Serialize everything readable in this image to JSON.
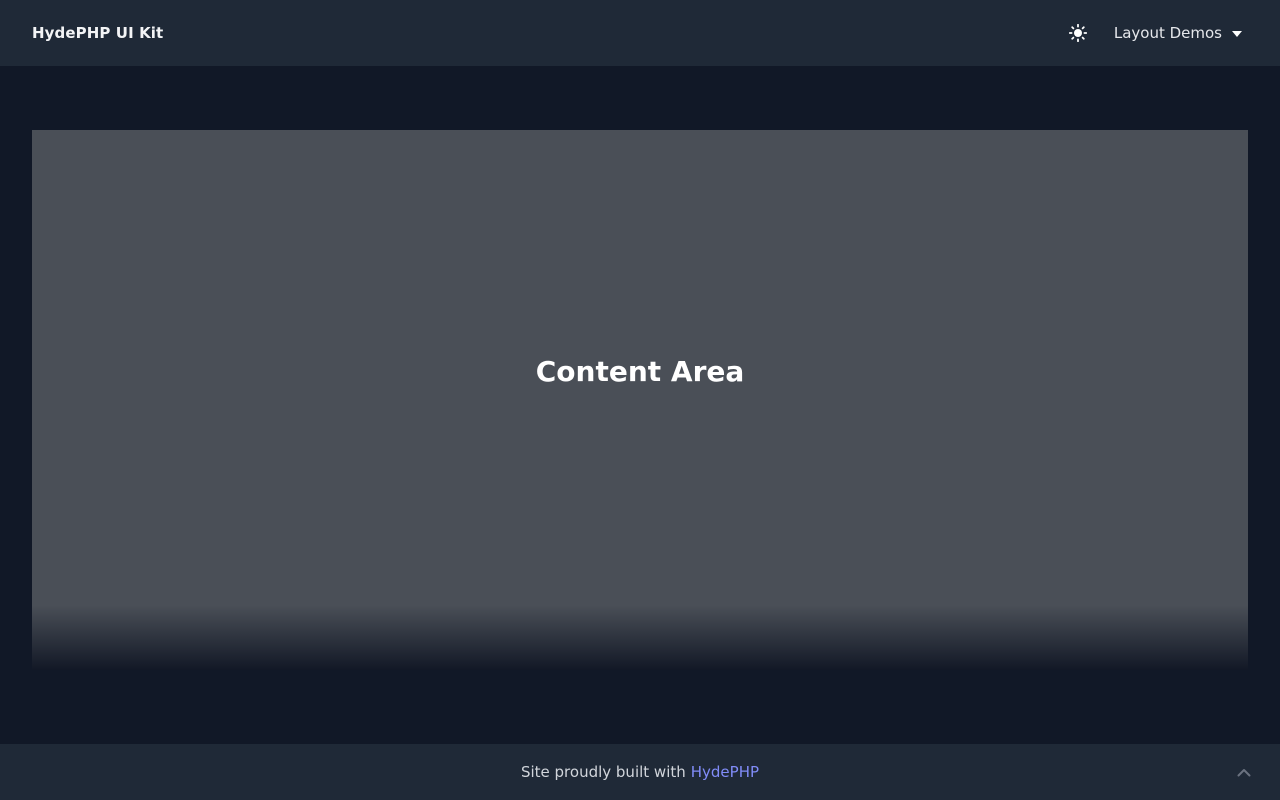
{
  "navbar": {
    "brand": "HydePHP UI Kit",
    "theme_toggle_icon": "sun-icon",
    "dropdown_label": "Layout Demos",
    "dropdown_icon": "chevron-down-icon"
  },
  "main": {
    "title": "Content Area"
  },
  "footer": {
    "text": "Site proudly built with",
    "link_text": "HydePHP",
    "link_color": "#818cf8",
    "back_to_top_icon": "chevron-up-icon"
  },
  "colors": {
    "page_bg": "#111827",
    "bar_bg": "#1f2937",
    "content_bg": "#4a4f57"
  }
}
